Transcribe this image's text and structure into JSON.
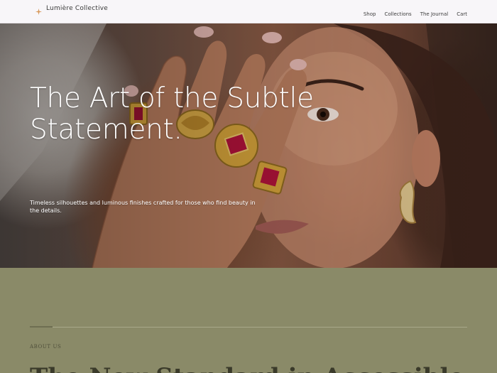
{
  "header": {
    "brand_icon": "sparkle-icon",
    "brand_name": "Lumière Collective",
    "nav": [
      "Shop",
      "Collections",
      "The Journal",
      "Cart"
    ]
  },
  "hero": {
    "title": "The Art of the Subtle Statement.",
    "subtitle": "Timeless silhouettes and luminous finishes crafted for those who find beauty in the details."
  },
  "about": {
    "label": "ABOUT US",
    "heading": "The New Standard in Accessible"
  },
  "colors": {
    "header_bg": "#f8f6f9",
    "about_bg": "#8a8a68",
    "brand_accent": "#d89a5c",
    "gold": "#d4a23a",
    "ruby": "#b0123a"
  }
}
